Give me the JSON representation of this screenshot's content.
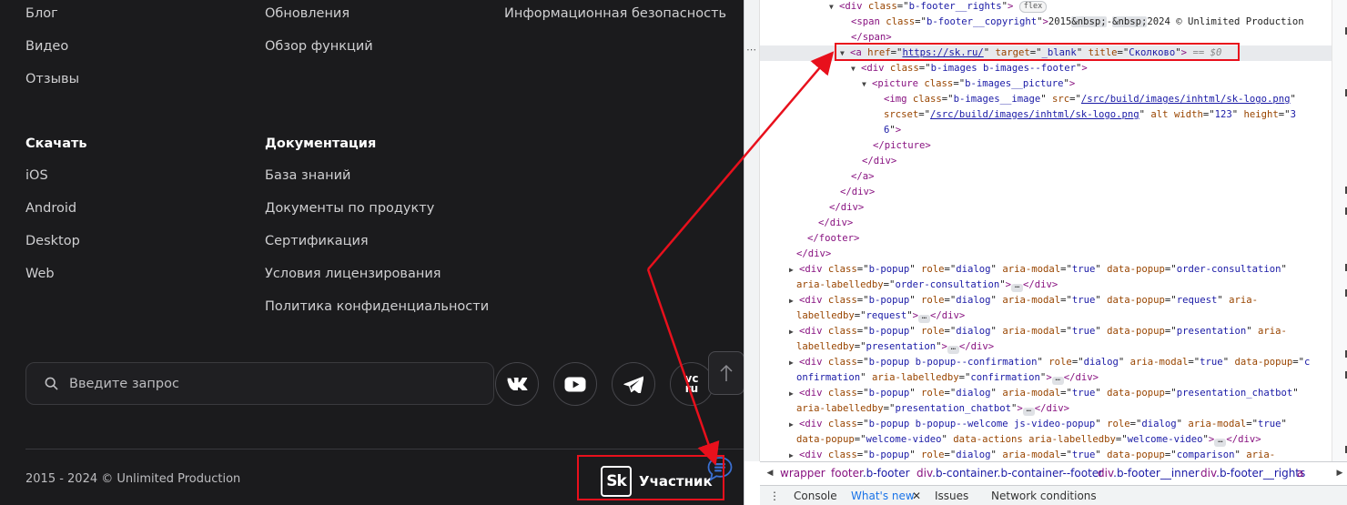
{
  "footer": {
    "col1_top": [
      "Блог",
      "Видео",
      "Отзывы"
    ],
    "col2_top": [
      "Обновления",
      "Обзор функций"
    ],
    "col3_top": [
      "Информационная безопасность"
    ],
    "download": {
      "title": "Скачать",
      "items": [
        "iOS",
        "Android",
        "Desktop",
        "Web"
      ]
    },
    "docs": {
      "title": "Документация",
      "items": [
        "База знаний",
        "Документы по продукту",
        "Сертификация",
        "Условия лицензирования",
        "Политика конфиденциальности"
      ]
    },
    "search_placeholder": "Введите запрос",
    "social": [
      "vk-icon",
      "youtube-icon",
      "telegram-icon",
      "vc-ru-icon"
    ],
    "vc_label_top": "vc",
    "vc_label_bottom": "ru",
    "copyright": "2015 - 2024 © Unlimited Production",
    "sk_mark": "Sk",
    "sk_label": "Участник"
  },
  "devtools": {
    "lines": [
      {
        "html": "<span class=\"tri\">▼</span><span class=\"tg\">&lt;div</span> <span class=\"an\">class</span>=\"<span class=\"av\">b-footer__rights</span>\"<span class=\"tg\">&gt;</span> <span class=\"pill\">flex</span>"
      },
      {
        "html": "<span class=\"tg\">&lt;span</span> <span class=\"an\">class</span>=\"<span class=\"av\">b-footer__copyright</span>\"<span class=\"tg\">&gt;</span><span class=\"tx\">2015<span class=\"ent\">&amp;nbsp;</span>-<span class=\"ent\">&amp;nbsp;</span>2024 © Unlimited Production</span>"
      },
      {
        "html": "<span class=\"tg\">&lt;/span&gt;</span>"
      },
      {
        "html": "<span class=\"tri\">▼</span><span class=\"tg\">&lt;a</span> <span class=\"an\">href</span>=\"<span class=\"al\">https://sk.ru/</span>\" <span class=\"an\">target</span>=\"<span class=\"av\">_blank</span>\" <span class=\"an\">title</span>=\"<span class=\"av\">Сколково</span>\"<span class=\"tg\">&gt;</span> <span class=\"eq\">== $0</span>"
      },
      {
        "html": "<span class=\"tri\">▼</span><span class=\"tg\">&lt;div</span> <span class=\"an\">class</span>=\"<span class=\"av\">b-images b-images--footer</span>\"<span class=\"tg\">&gt;</span>"
      },
      {
        "html": "<span class=\"tri\">▼</span><span class=\"tg\">&lt;picture</span> <span class=\"an\">class</span>=\"<span class=\"av\">b-images__picture</span>\"<span class=\"tg\">&gt;</span>"
      },
      {
        "html": "<span class=\"tg\">&lt;img</span> <span class=\"an\">class</span>=\"<span class=\"av\">b-images__image</span>\" <span class=\"an\">src</span>=\"<span class=\"al\">/src/build/images/inhtml/sk-logo.png</span>\""
      },
      {
        "html": "<span class=\"an\">srcset</span>=\"<span class=\"al\">/src/build/images/inhtml/sk-logo.png</span>\" <span class=\"an\">alt</span> <span class=\"an\">width</span>=\"<span class=\"av\">123</span>\" <span class=\"an\">height</span>=\"<span class=\"av\">3</span>"
      },
      {
        "html": "<span class=\"av\">6</span>\"<span class=\"tg\">&gt;</span>"
      },
      {
        "html": "<span class=\"tg\">&lt;/picture&gt;</span>"
      },
      {
        "html": "<span class=\"tg\">&lt;/div&gt;</span>"
      },
      {
        "html": "<span class=\"tg\">&lt;/a&gt;</span>"
      },
      {
        "html": "<span class=\"tg\">&lt;/div&gt;</span>"
      },
      {
        "html": "<span class=\"tg\">&lt;/div&gt;</span>"
      },
      {
        "html": "<span class=\"tg\">&lt;/div&gt;</span>"
      },
      {
        "html": "<span class=\"tg\">&lt;/footer&gt;</span>"
      },
      {
        "html": "<span class=\"tg\">&lt;/div&gt;</span>"
      },
      {
        "html": "<span class=\"tri\">▶</span><span class=\"tg\">&lt;div</span> <span class=\"an\">class</span>=\"<span class=\"av\">b-popup</span>\" <span class=\"an\">role</span>=\"<span class=\"av\">dialog</span>\" <span class=\"an\">aria-modal</span>=\"<span class=\"av\">true</span>\" <span class=\"an\">data-popup</span>=\"<span class=\"av\">order-consultation</span>\""
      },
      {
        "html": "<span class=\"an\">aria-labelledby</span>=\"<span class=\"av\">order-consultation</span>\"<span class=\"tg\">&gt;</span><span class=\"ell\">…</span><span class=\"tg\">&lt;/div&gt;</span>"
      },
      {
        "html": "<span class=\"tri\">▶</span><span class=\"tg\">&lt;div</span> <span class=\"an\">class</span>=\"<span class=\"av\">b-popup</span>\" <span class=\"an\">role</span>=\"<span class=\"av\">dialog</span>\" <span class=\"an\">aria-modal</span>=\"<span class=\"av\">true</span>\" <span class=\"an\">data-popup</span>=\"<span class=\"av\">request</span>\" <span class=\"an\">aria-</span>"
      },
      {
        "html": "<span class=\"an\">labelledby</span>=\"<span class=\"av\">request</span>\"<span class=\"tg\">&gt;</span><span class=\"ell\">…</span><span class=\"tg\">&lt;/div&gt;</span>"
      },
      {
        "html": "<span class=\"tri\">▶</span><span class=\"tg\">&lt;div</span> <span class=\"an\">class</span>=\"<span class=\"av\">b-popup</span>\" <span class=\"an\">role</span>=\"<span class=\"av\">dialog</span>\" <span class=\"an\">aria-modal</span>=\"<span class=\"av\">true</span>\" <span class=\"an\">data-popup</span>=\"<span class=\"av\">presentation</span>\" <span class=\"an\">aria-</span>"
      },
      {
        "html": "<span class=\"an\">labelledby</span>=\"<span class=\"av\">presentation</span>\"<span class=\"tg\">&gt;</span><span class=\"ell\">…</span><span class=\"tg\">&lt;/div&gt;</span>"
      },
      {
        "html": "<span class=\"tri\">▶</span><span class=\"tg\">&lt;div</span> <span class=\"an\">class</span>=\"<span class=\"av\">b-popup b-popup--confirmation</span>\" <span class=\"an\">role</span>=\"<span class=\"av\">dialog</span>\" <span class=\"an\">aria-modal</span>=\"<span class=\"av\">true</span>\" <span class=\"an\">data-popup</span>=\"<span class=\"av\">c</span>"
      },
      {
        "html": "<span class=\"av\">onfirmation</span>\" <span class=\"an\">aria-labelledby</span>=\"<span class=\"av\">confirmation</span>\"<span class=\"tg\">&gt;</span><span class=\"ell\">…</span><span class=\"tg\">&lt;/div&gt;</span>"
      },
      {
        "html": "<span class=\"tri\">▶</span><span class=\"tg\">&lt;div</span> <span class=\"an\">class</span>=\"<span class=\"av\">b-popup</span>\" <span class=\"an\">role</span>=\"<span class=\"av\">dialog</span>\" <span class=\"an\">aria-modal</span>=\"<span class=\"av\">true</span>\" <span class=\"an\">data-popup</span>=\"<span class=\"av\">presentation_chatbot</span>\""
      },
      {
        "html": "<span class=\"an\">aria-labelledby</span>=\"<span class=\"av\">presentation_chatbot</span>\"<span class=\"tg\">&gt;</span><span class=\"ell\">…</span><span class=\"tg\">&lt;/div&gt;</span>"
      },
      {
        "html": "<span class=\"tri\">▶</span><span class=\"tg\">&lt;div</span> <span class=\"an\">class</span>=\"<span class=\"av\">b-popup b-popup--welcome js-video-popup</span>\" <span class=\"an\">role</span>=\"<span class=\"av\">dialog</span>\" <span class=\"an\">aria-modal</span>=\"<span class=\"av\">true</span>\""
      },
      {
        "html": "<span class=\"an\">data-popup</span>=\"<span class=\"av\">welcome-video</span>\" <span class=\"an\">data-actions</span> <span class=\"an\">aria-labelledby</span>=\"<span class=\"av\">welcome-video</span>\"<span class=\"tg\">&gt;</span><span class=\"ell\">…</span><span class=\"tg\">&lt;/div&gt;</span>"
      },
      {
        "html": "<span class=\"tri\">▶</span><span class=\"tg\">&lt;div</span> <span class=\"an\">class</span>=\"<span class=\"av\">b-popup</span>\" <span class=\"an\">role</span>=\"<span class=\"av\">dialog</span>\" <span class=\"an\">aria-modal</span>=\"<span class=\"av\">true</span>\" <span class=\"an\">data-popup</span>=\"<span class=\"av\">comparison</span>\" <span class=\"an\">aria-</span>"
      }
    ],
    "selected_line": 3,
    "breadcrumbs": [
      {
        "tag": "wrapper",
        "cls": ""
      },
      {
        "tag": "footer",
        "cls": ".b-footer"
      },
      {
        "tag": "div",
        "cls": ".b-container.b-container--footer"
      },
      {
        "tag": "div",
        "cls": ".b-footer__inner"
      },
      {
        "tag": "div",
        "cls": ".b-footer__rights"
      },
      {
        "tag": "a",
        "cls": ""
      }
    ],
    "drawer_tabs": [
      "Console",
      "What's new",
      "Issues",
      "Network conditions"
    ],
    "drawer_close": "✕",
    "drawer_menu": "⋮"
  },
  "colors": {
    "highlight": "#e8101c",
    "footer_bg": "#1b1b1d",
    "tag": "#881280",
    "attr_name": "#994500",
    "attr_value": "#1a1aa6"
  }
}
